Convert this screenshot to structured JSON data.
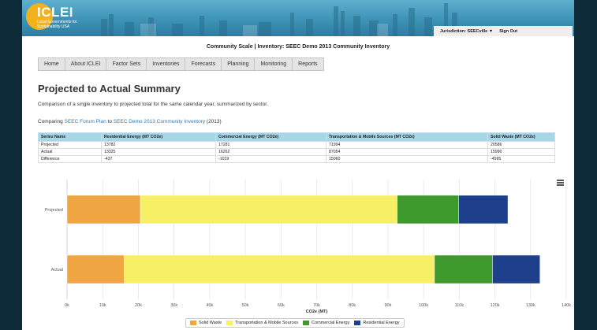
{
  "header": {
    "logo_name": "ICLEI",
    "logo_subtitle": "Local Governments for Sustainability USA",
    "jurisdiction_label": "Jurisdiction: SEECville ▼",
    "sign_out": "Sign Out"
  },
  "context_title": "Community Scale | Inventory: SEEC Demo 2013 Community Inventory",
  "nav": [
    "Home",
    "About ICLEI",
    "Factor Sets",
    "Inventories",
    "Forecasts",
    "Planning",
    "Monitoring",
    "Reports"
  ],
  "page": {
    "heading": "Projected to Actual Summary",
    "description": "Comparison of a single inventory to projected total for the same calendar year, summarized by sector.",
    "comparing_prefix": "Comparing",
    "comparing_plan": "SEEC Forum Plan",
    "comparing_to": "to",
    "comparing_inventory": "SEEC Demo 2013 Community Inventory",
    "comparing_year": "(2013)"
  },
  "table": {
    "headers": [
      "Series Name",
      "Residential Energy (MT CO2e)",
      "Commercial Energy (MT CO2e)",
      "Transportation & Mobile Sources (MT CO2e)",
      "Solid Waste (MT CO2e)"
    ],
    "rows": [
      [
        "Projected",
        "13782",
        "17281",
        "71994",
        "20586"
      ],
      [
        "Actual",
        "13325",
        "16262",
        "87054",
        "15990"
      ],
      [
        "Difference",
        "-437",
        "-1019",
        "15060",
        "-4595"
      ]
    ]
  },
  "chart_data": {
    "type": "bar",
    "orientation": "horizontal",
    "stacked": true,
    "categories": [
      "Projected",
      "Actual"
    ],
    "series": [
      {
        "name": "Solid Waste",
        "color": "#f0a543",
        "values": [
          20586,
          15990
        ]
      },
      {
        "name": "Transportation & Mobile Sources",
        "color": "#f7f066",
        "values": [
          71994,
          87054
        ]
      },
      {
        "name": "Commercial Energy",
        "color": "#3f9a2e",
        "values": [
          17281,
          16262
        ]
      },
      {
        "name": "Residential Energy",
        "color": "#1d3f8c",
        "values": [
          13782,
          13325
        ]
      }
    ],
    "xlabel": "CO2e (MT)",
    "xlim": [
      0,
      140000
    ],
    "xticks": [
      "0k",
      "10k",
      "20k",
      "30k",
      "40k",
      "50k",
      "60k",
      "70k",
      "80k",
      "90k",
      "100k",
      "110k",
      "120k",
      "130k",
      "140k"
    ],
    "grid": true,
    "legend_position": "bottom"
  },
  "colors": {
    "accent": "#2a7db5",
    "table_header": "#a6d6e8",
    "banner": "#3d93b5",
    "logo": "#f2b21c"
  }
}
